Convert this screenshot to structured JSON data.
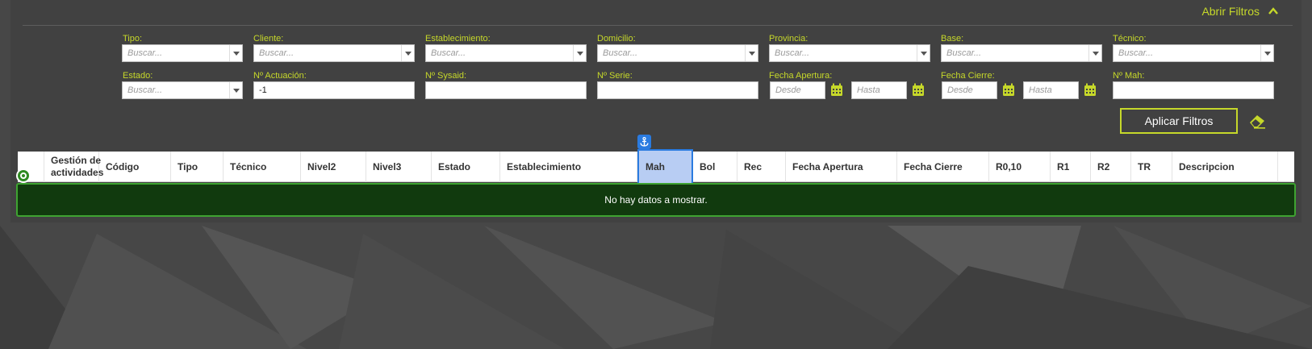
{
  "filters_toggle": {
    "label": "Abrir Filtros",
    "icon": "chevron-up-icon"
  },
  "filters": {
    "tipo": {
      "label": "Tipo:",
      "placeholder": "Buscar..."
    },
    "cliente": {
      "label": "Cliente:",
      "placeholder": "Buscar..."
    },
    "establecimiento": {
      "label": "Establecimiento:",
      "placeholder": "Buscar..."
    },
    "domicilio": {
      "label": "Domicilio:",
      "placeholder": "Buscar..."
    },
    "provincia": {
      "label": "Provincia:",
      "placeholder": "Buscar..."
    },
    "base": {
      "label": "Base:",
      "placeholder": "Buscar..."
    },
    "tecnico": {
      "label": "Técnico:",
      "placeholder": "Buscar..."
    },
    "estado": {
      "label": "Estado:",
      "placeholder": "Buscar..."
    },
    "n_actuacion": {
      "label": "Nº Actuación:",
      "value": "-1"
    },
    "n_sysaid": {
      "label": "Nº Sysaid:",
      "value": ""
    },
    "n_serie": {
      "label": "Nº Serie:",
      "value": ""
    },
    "fecha_apertura": {
      "label": "Fecha Apertura:",
      "desde": "Desde",
      "hasta": "Hasta"
    },
    "fecha_cierre": {
      "label": "Fecha Cierre:",
      "desde": "Desde",
      "hasta": "Hasta"
    },
    "n_mah": {
      "label": "Nº Mah:",
      "value": ""
    }
  },
  "apply_button": {
    "label": "Aplicar Filtros"
  },
  "table": {
    "columns": [
      "",
      "Gestión de actividades",
      "Código",
      "Tipo",
      "Técnico",
      "Nivel2",
      "Nivel3",
      "Estado",
      "Establecimiento",
      "Mah",
      "Bol",
      "Rec",
      "Fecha Apertura",
      "Fecha Cierre",
      "R0,10",
      "R1",
      "R2",
      "TR",
      "Descripcion"
    ],
    "highlighted_column": "Mah",
    "empty_message": "No hay datos a mostrar."
  },
  "colors": {
    "accent": "#c6d82a",
    "panel": "#414141",
    "highlight": "#b8cdf3",
    "nodata_bg": "#113a0e",
    "nodata_border": "#3ea331"
  }
}
